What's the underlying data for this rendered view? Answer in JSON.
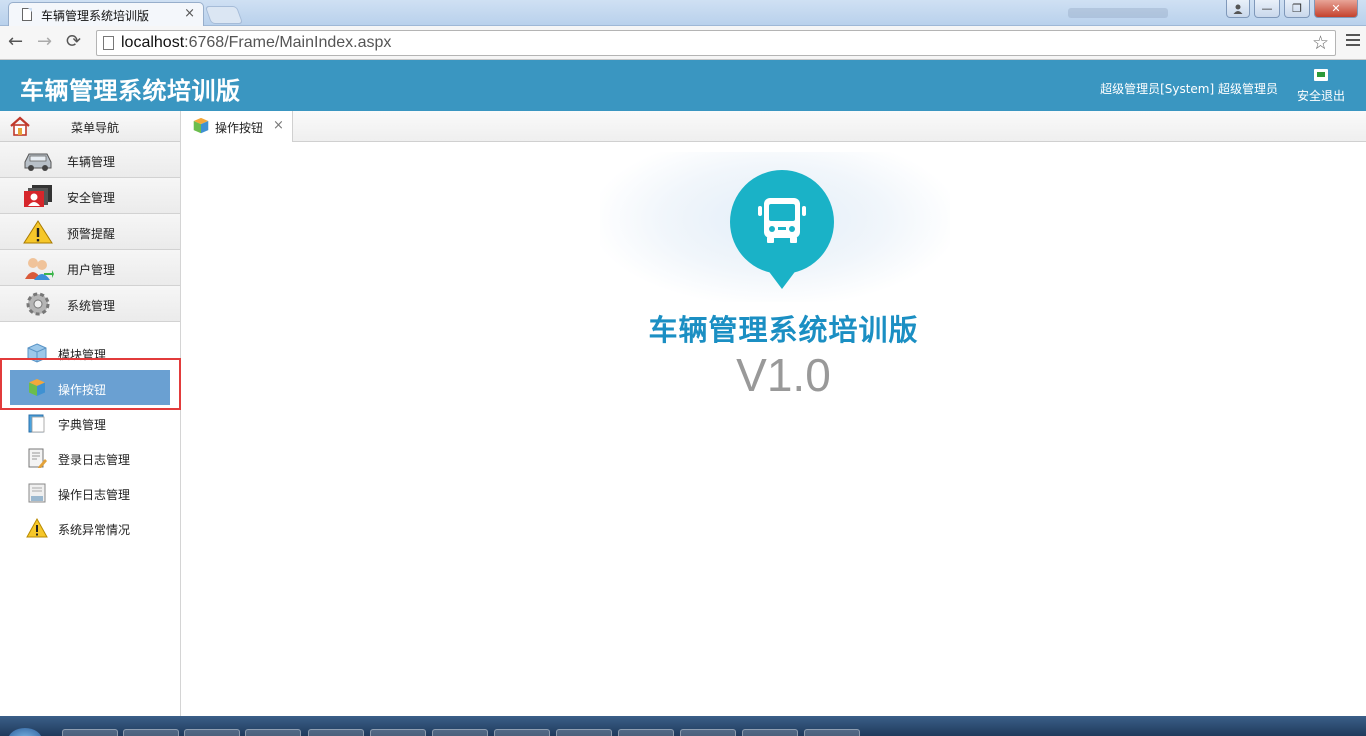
{
  "browser": {
    "tab_title": "车辆管理系统培训版",
    "tab_close": "×",
    "url_host": "localhost",
    "url_rest": ":6768/Frame/MainIndex.aspx",
    "buttons": {
      "back": "←",
      "forward": "→",
      "reload": "⟳",
      "bookmark": "☆"
    },
    "window": {
      "minimize": "—",
      "restore": "❐",
      "close": "✕",
      "user": "👤"
    }
  },
  "header": {
    "title": "车辆管理系统培训版",
    "user_info": "超级管理员[System] 超级管理员",
    "logout_label": "安全退出"
  },
  "sidebar": {
    "title": "菜单导航",
    "categories": [
      {
        "label": "车辆管理",
        "icon": "car-icon"
      },
      {
        "label": "安全管理",
        "icon": "security-icon"
      },
      {
        "label": "预警提醒",
        "icon": "warning-icon"
      },
      {
        "label": "用户管理",
        "icon": "users-icon"
      },
      {
        "label": "系统管理",
        "icon": "gear-icon"
      }
    ],
    "subitems": [
      {
        "label": "模块管理",
        "icon": "module-icon"
      },
      {
        "label": "操作按钮",
        "icon": "buttons-icon",
        "active": true
      },
      {
        "label": "字典管理",
        "icon": "dictionary-icon"
      },
      {
        "label": "登录日志管理",
        "icon": "login-log-icon"
      },
      {
        "label": "操作日志管理",
        "icon": "operation-log-icon"
      },
      {
        "label": "系统异常情况",
        "icon": "exception-icon"
      }
    ]
  },
  "tabs": [
    {
      "label": "操作按钮",
      "close": "×"
    }
  ],
  "splash": {
    "title": "车辆管理系统培训版",
    "version": "V1.0"
  },
  "colors": {
    "header_bg": "#3a96c1",
    "active_item_bg": "#6aa0d2",
    "splash_pin": "#1ab2c7",
    "splash_title": "#1b8fc3",
    "highlight_box": "#e23b3b"
  }
}
